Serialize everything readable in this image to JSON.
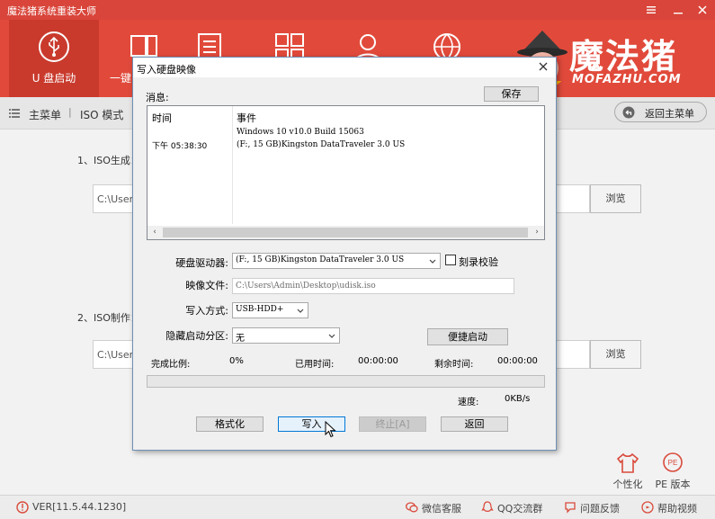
{
  "app": {
    "title": "魔法猪系统重装大师",
    "nav": [
      {
        "label": "U 盘启动",
        "icon": "usb-icon",
        "active": true
      },
      {
        "label": "一键",
        "icon": "computer-icon",
        "active": false
      },
      {
        "label": "",
        "icon": "document-icon",
        "active": false
      },
      {
        "label": "",
        "icon": "grid-icon",
        "active": false
      },
      {
        "label": "",
        "icon": "user-icon",
        "active": false
      },
      {
        "label": "",
        "icon": "globe-icon",
        "active": false
      }
    ],
    "logo": {
      "cn": "魔法猪",
      "en": "MOFAZHU.COM"
    },
    "breadcrumb": {
      "main": "主菜单",
      "sep": "|",
      "current": "ISO 模式"
    },
    "back_button": "返回主菜单",
    "section1_label": "1、ISO生成：",
    "section1_path": "C:\\Users",
    "section2_label": "2、ISO制作：",
    "section2_path": "C:\\Users",
    "browse_label": "浏览",
    "side_icons": [
      {
        "label": "个性化",
        "icon": "shirt-icon"
      },
      {
        "label": "PE 版本",
        "icon": "pe-badge-icon"
      }
    ],
    "status": {
      "version": "VER[11.5.44.1230]",
      "links": [
        {
          "label": "微信客服",
          "icon": "wechat-icon"
        },
        {
          "label": "QQ交流群",
          "icon": "qq-icon"
        },
        {
          "label": "问题反馈",
          "icon": "feedback-icon"
        },
        {
          "label": "帮助视频",
          "icon": "help-icon"
        }
      ]
    },
    "colors": {
      "brand": "#e14a3b",
      "brand_dark": "#c93a2d",
      "progress": "#06b025"
    }
  },
  "dialog": {
    "title": "写入硬盘映像",
    "messages_label": "消息:",
    "save_button": "保存",
    "log": {
      "col_time": "时间",
      "col_event": "事件",
      "rows": [
        {
          "time": "",
          "event": "Windows 10 v10.0 Build 15063"
        },
        {
          "time": "下午 05:38:30",
          "event": "(F:, 15 GB)Kingston DataTraveler 3.0 US"
        }
      ]
    },
    "drive_label": "硬盘驱动器:",
    "drive_value": "(F:, 15 GB)Kingston DataTraveler 3.0 US",
    "verify_label": "刻录校验",
    "verify_checked": false,
    "image_label": "映像文件:",
    "image_value": "C:\\Users\\Admin\\Desktop\\udisk.iso",
    "write_mode_label": "写入方式:",
    "write_mode_value": "USB-HDD+",
    "hidden_partition_label": "隐藏启动分区:",
    "hidden_partition_value": "无",
    "quick_boot_button": "便捷启动",
    "progress": {
      "percent_label": "完成比例:",
      "percent_value": "0%",
      "elapsed_label": "已用时间:",
      "elapsed_value": "00:00:00",
      "remaining_label": "剩余时间:",
      "remaining_value": "00:00:00",
      "speed_label": "速度:",
      "speed_value": "0KB/s",
      "fraction": 0
    },
    "buttons": {
      "format": "格式化",
      "write": "写入",
      "stop": "终止[A]",
      "back": "返回"
    }
  }
}
